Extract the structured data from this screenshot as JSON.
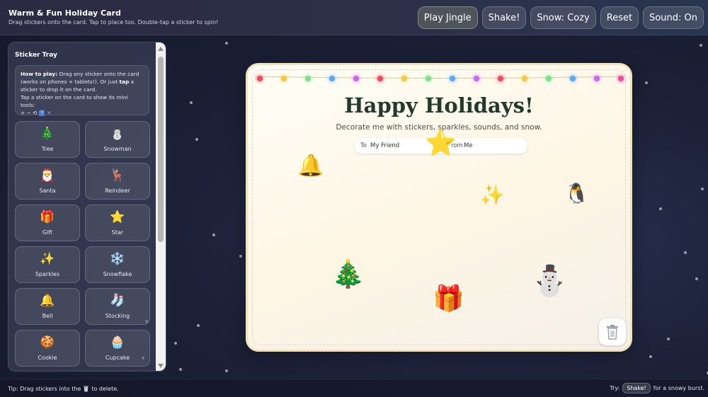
{
  "header": {
    "title": "Warm & Fun Holiday Card",
    "subtitle": "Drag stickers onto the card. Tap to place too. Double-tap a sticker to spin!"
  },
  "toolbar": {
    "play_jingle": "Play Jingle",
    "shake": "Shake!",
    "snow": "Snow: Cozy",
    "reset": "Reset",
    "sound": "Sound: On"
  },
  "sidebar": {
    "title": "Sticker Tray",
    "howto_heading": "How to play:",
    "howto_text_1": " Drag any sticker onto the card (works on phones + tablets!). Or just ",
    "howto_tap": "tap",
    "howto_text_2": " a sticker to drop it on the card.",
    "howto_text_3": "Tap a sticker on the card to show its mini tools:",
    "howto_tools": "+ − ⟲",
    "items": [
      {
        "emoji": "🎄",
        "label": "Tree"
      },
      {
        "emoji": "⛄",
        "label": "Snowman"
      },
      {
        "emoji": "🎅",
        "label": "Santa"
      },
      {
        "emoji": "🦌",
        "label": "Reindeer"
      },
      {
        "emoji": "🎁",
        "label": "Gift"
      },
      {
        "emoji": "⭐",
        "label": "Star"
      },
      {
        "emoji": "✨",
        "label": "Sparkles"
      },
      {
        "emoji": "❄️",
        "label": "Snowflake"
      },
      {
        "emoji": "🔔",
        "label": "Bell"
      },
      {
        "emoji": "🧦",
        "label": "Stocking"
      },
      {
        "emoji": "🍪",
        "label": "Cookie"
      },
      {
        "emoji": "🧁",
        "label": "Cupcake"
      }
    ]
  },
  "card": {
    "title": "Happy Holidays!",
    "subtitle": "Decorate me with stickers, sparkles, sounds, and snow.",
    "to_label": "To",
    "to_value": "My Friend",
    "from_label": "rom",
    "from_value": "Me",
    "bulb_colors": [
      "#f04a5a",
      "#f5c842",
      "#7be08a",
      "#5aa8f0",
      "#c56af0",
      "#f04a5a",
      "#f5c842",
      "#7be08a",
      "#5aa8f0",
      "#c56af0",
      "#f04a5a",
      "#f5c842",
      "#7be08a",
      "#5aa8f0",
      "#c56af0",
      "#f04aa0"
    ],
    "stickers": [
      {
        "name": "star",
        "emoji": "⭐"
      },
      {
        "name": "bell",
        "emoji": "🔔"
      },
      {
        "name": "sparkles",
        "emoji": "✨"
      },
      {
        "name": "penguin",
        "emoji": "🐧"
      },
      {
        "name": "tree",
        "emoji": "🎄"
      },
      {
        "name": "gift",
        "emoji": "🎁"
      },
      {
        "name": "snowman",
        "emoji": "⛄"
      }
    ]
  },
  "footer": {
    "tip_before": "Tip: Drag stickers into the",
    "tip_after": "to delete.",
    "try_label": "Try:",
    "try_button": "Shake!",
    "try_after": "for a snowy burst."
  },
  "colors": {
    "card_title": "#213a2c",
    "accent_blue": "#4a7fd6"
  }
}
